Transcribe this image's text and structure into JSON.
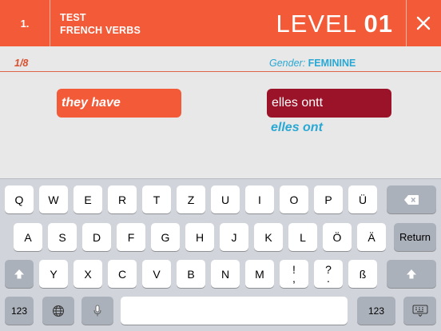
{
  "header": {
    "number": "1.",
    "title_line1": "TEST",
    "title_line2": "FRENCH VERBS",
    "level_word": "LEVEL",
    "level_number": "01",
    "close_icon": "close-icon"
  },
  "status": {
    "progress": "1/8",
    "gender_label": "Gender:",
    "gender_value": "FEMININE"
  },
  "exercise": {
    "prompt": "they have",
    "answer_input": "elles ontt",
    "correct_answer": "elles ont"
  },
  "colors": {
    "accent": "#f25a38",
    "wrong": "#9b1328",
    "info": "#2aa8d4"
  },
  "keyboard": {
    "row1": [
      "Q",
      "W",
      "E",
      "R",
      "T",
      "Z",
      "U",
      "I",
      "O",
      "P",
      "Ü"
    ],
    "row2": [
      "A",
      "S",
      "D",
      "F",
      "G",
      "H",
      "J",
      "K",
      "L",
      "Ö",
      "Ä"
    ],
    "row3": [
      "Y",
      "X",
      "C",
      "V",
      "B",
      "N",
      "M"
    ],
    "row3_punct": [
      {
        "top": "!",
        "bottom": ","
      },
      {
        "top": "?",
        "bottom": "."
      }
    ],
    "row3_last": "ß",
    "return_label": "Return",
    "numbers_label": "123",
    "icons": {
      "delete": "backspace-icon",
      "shift": "shift-icon",
      "globe": "globe-icon",
      "mic": "microphone-icon",
      "hide": "keyboard-hide-icon"
    }
  }
}
